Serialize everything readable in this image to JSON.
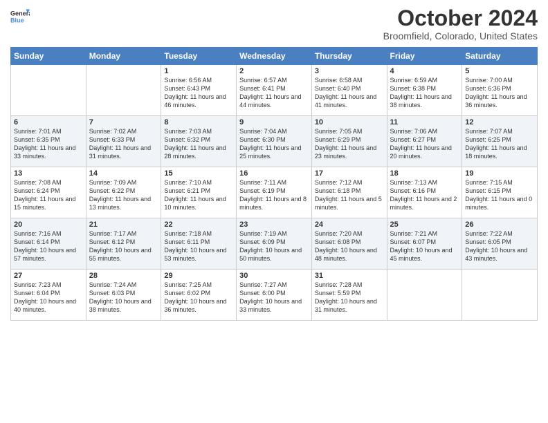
{
  "logo": {
    "line1": "General",
    "line2": "Blue"
  },
  "title": "October 2024",
  "location": "Broomfield, Colorado, United States",
  "days_of_week": [
    "Sunday",
    "Monday",
    "Tuesday",
    "Wednesday",
    "Thursday",
    "Friday",
    "Saturday"
  ],
  "weeks": [
    [
      {
        "day": "",
        "info": ""
      },
      {
        "day": "",
        "info": ""
      },
      {
        "day": "1",
        "info": "Sunrise: 6:56 AM\nSunset: 6:43 PM\nDaylight: 11 hours and 46 minutes."
      },
      {
        "day": "2",
        "info": "Sunrise: 6:57 AM\nSunset: 6:41 PM\nDaylight: 11 hours and 44 minutes."
      },
      {
        "day": "3",
        "info": "Sunrise: 6:58 AM\nSunset: 6:40 PM\nDaylight: 11 hours and 41 minutes."
      },
      {
        "day": "4",
        "info": "Sunrise: 6:59 AM\nSunset: 6:38 PM\nDaylight: 11 hours and 38 minutes."
      },
      {
        "day": "5",
        "info": "Sunrise: 7:00 AM\nSunset: 6:36 PM\nDaylight: 11 hours and 36 minutes."
      }
    ],
    [
      {
        "day": "6",
        "info": "Sunrise: 7:01 AM\nSunset: 6:35 PM\nDaylight: 11 hours and 33 minutes."
      },
      {
        "day": "7",
        "info": "Sunrise: 7:02 AM\nSunset: 6:33 PM\nDaylight: 11 hours and 31 minutes."
      },
      {
        "day": "8",
        "info": "Sunrise: 7:03 AM\nSunset: 6:32 PM\nDaylight: 11 hours and 28 minutes."
      },
      {
        "day": "9",
        "info": "Sunrise: 7:04 AM\nSunset: 6:30 PM\nDaylight: 11 hours and 25 minutes."
      },
      {
        "day": "10",
        "info": "Sunrise: 7:05 AM\nSunset: 6:29 PM\nDaylight: 11 hours and 23 minutes."
      },
      {
        "day": "11",
        "info": "Sunrise: 7:06 AM\nSunset: 6:27 PM\nDaylight: 11 hours and 20 minutes."
      },
      {
        "day": "12",
        "info": "Sunrise: 7:07 AM\nSunset: 6:25 PM\nDaylight: 11 hours and 18 minutes."
      }
    ],
    [
      {
        "day": "13",
        "info": "Sunrise: 7:08 AM\nSunset: 6:24 PM\nDaylight: 11 hours and 15 minutes."
      },
      {
        "day": "14",
        "info": "Sunrise: 7:09 AM\nSunset: 6:22 PM\nDaylight: 11 hours and 13 minutes."
      },
      {
        "day": "15",
        "info": "Sunrise: 7:10 AM\nSunset: 6:21 PM\nDaylight: 11 hours and 10 minutes."
      },
      {
        "day": "16",
        "info": "Sunrise: 7:11 AM\nSunset: 6:19 PM\nDaylight: 11 hours and 8 minutes."
      },
      {
        "day": "17",
        "info": "Sunrise: 7:12 AM\nSunset: 6:18 PM\nDaylight: 11 hours and 5 minutes."
      },
      {
        "day": "18",
        "info": "Sunrise: 7:13 AM\nSunset: 6:16 PM\nDaylight: 11 hours and 2 minutes."
      },
      {
        "day": "19",
        "info": "Sunrise: 7:15 AM\nSunset: 6:15 PM\nDaylight: 11 hours and 0 minutes."
      }
    ],
    [
      {
        "day": "20",
        "info": "Sunrise: 7:16 AM\nSunset: 6:14 PM\nDaylight: 10 hours and 57 minutes."
      },
      {
        "day": "21",
        "info": "Sunrise: 7:17 AM\nSunset: 6:12 PM\nDaylight: 10 hours and 55 minutes."
      },
      {
        "day": "22",
        "info": "Sunrise: 7:18 AM\nSunset: 6:11 PM\nDaylight: 10 hours and 53 minutes."
      },
      {
        "day": "23",
        "info": "Sunrise: 7:19 AM\nSunset: 6:09 PM\nDaylight: 10 hours and 50 minutes."
      },
      {
        "day": "24",
        "info": "Sunrise: 7:20 AM\nSunset: 6:08 PM\nDaylight: 10 hours and 48 minutes."
      },
      {
        "day": "25",
        "info": "Sunrise: 7:21 AM\nSunset: 6:07 PM\nDaylight: 10 hours and 45 minutes."
      },
      {
        "day": "26",
        "info": "Sunrise: 7:22 AM\nSunset: 6:05 PM\nDaylight: 10 hours and 43 minutes."
      }
    ],
    [
      {
        "day": "27",
        "info": "Sunrise: 7:23 AM\nSunset: 6:04 PM\nDaylight: 10 hours and 40 minutes."
      },
      {
        "day": "28",
        "info": "Sunrise: 7:24 AM\nSunset: 6:03 PM\nDaylight: 10 hours and 38 minutes."
      },
      {
        "day": "29",
        "info": "Sunrise: 7:25 AM\nSunset: 6:02 PM\nDaylight: 10 hours and 36 minutes."
      },
      {
        "day": "30",
        "info": "Sunrise: 7:27 AM\nSunset: 6:00 PM\nDaylight: 10 hours and 33 minutes."
      },
      {
        "day": "31",
        "info": "Sunrise: 7:28 AM\nSunset: 5:59 PM\nDaylight: 10 hours and 31 minutes."
      },
      {
        "day": "",
        "info": ""
      },
      {
        "day": "",
        "info": ""
      }
    ]
  ]
}
